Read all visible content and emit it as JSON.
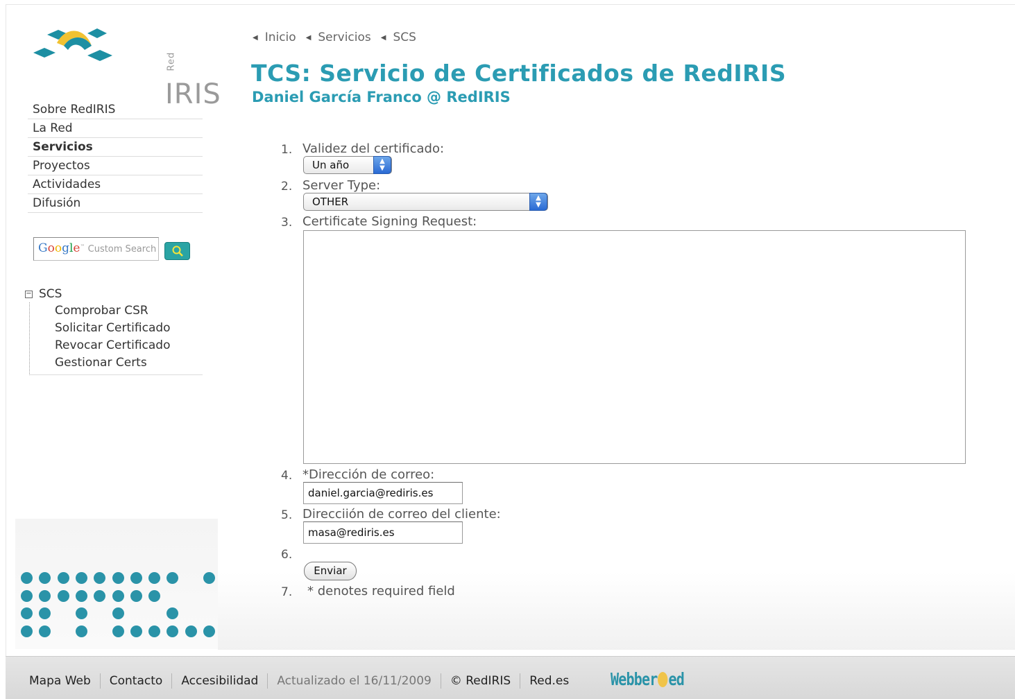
{
  "site": {
    "logo_text": "IRIS",
    "logo_small": "Red"
  },
  "breadcrumb": [
    "Inicio",
    "Servicios",
    "SCS"
  ],
  "title": "TCS: Servicio de Certificados de RedIRIS",
  "subtitle": "Daniel García Franco @ RedIRIS",
  "sidebar": {
    "nav": [
      "Sobre RedIRIS",
      "La Red",
      "Servicios",
      "Proyectos",
      "Actividades",
      "Difusión"
    ],
    "active": "Servicios",
    "search_placeholder": "Custom Search",
    "google_brand": "Google",
    "tree": {
      "root": "SCS",
      "toggle": "−",
      "children": [
        "Comprobar CSR",
        "Solicitar Certificado",
        "Revocar Certificado",
        "Gestionar Certs"
      ]
    }
  },
  "form": {
    "fields": [
      {
        "num": "1.",
        "label": "Validez del certificado:"
      },
      {
        "num": "2.",
        "label": "Server Type:"
      },
      {
        "num": "3.",
        "label": "Certificate Signing Request:"
      },
      {
        "num": "4.",
        "label": "*Dirección de correo:"
      },
      {
        "num": "5.",
        "label": "Direcciión de correo del cliente:"
      },
      {
        "num": "6.",
        "label": ""
      },
      {
        "num": "7.",
        "label": "* denotes required field"
      }
    ],
    "validity_value": "Un año",
    "server_type_value": "OTHER",
    "email_value": "daniel.garcia@rediris.es",
    "client_email_value": "masa@rediris.es",
    "submit_label": "Enviar"
  },
  "footer": {
    "links": [
      "Mapa Web",
      "Contacto",
      "Accesibilidad"
    ],
    "updated": "Actualizado el 16/11/2009",
    "copyright": "© RedIRIS",
    "rede": "Red.es",
    "webber_a": "Webber",
    "webber_b": "ed"
  },
  "colors": {
    "accent": "#2b9cb3",
    "dots": "#2a93a8"
  }
}
